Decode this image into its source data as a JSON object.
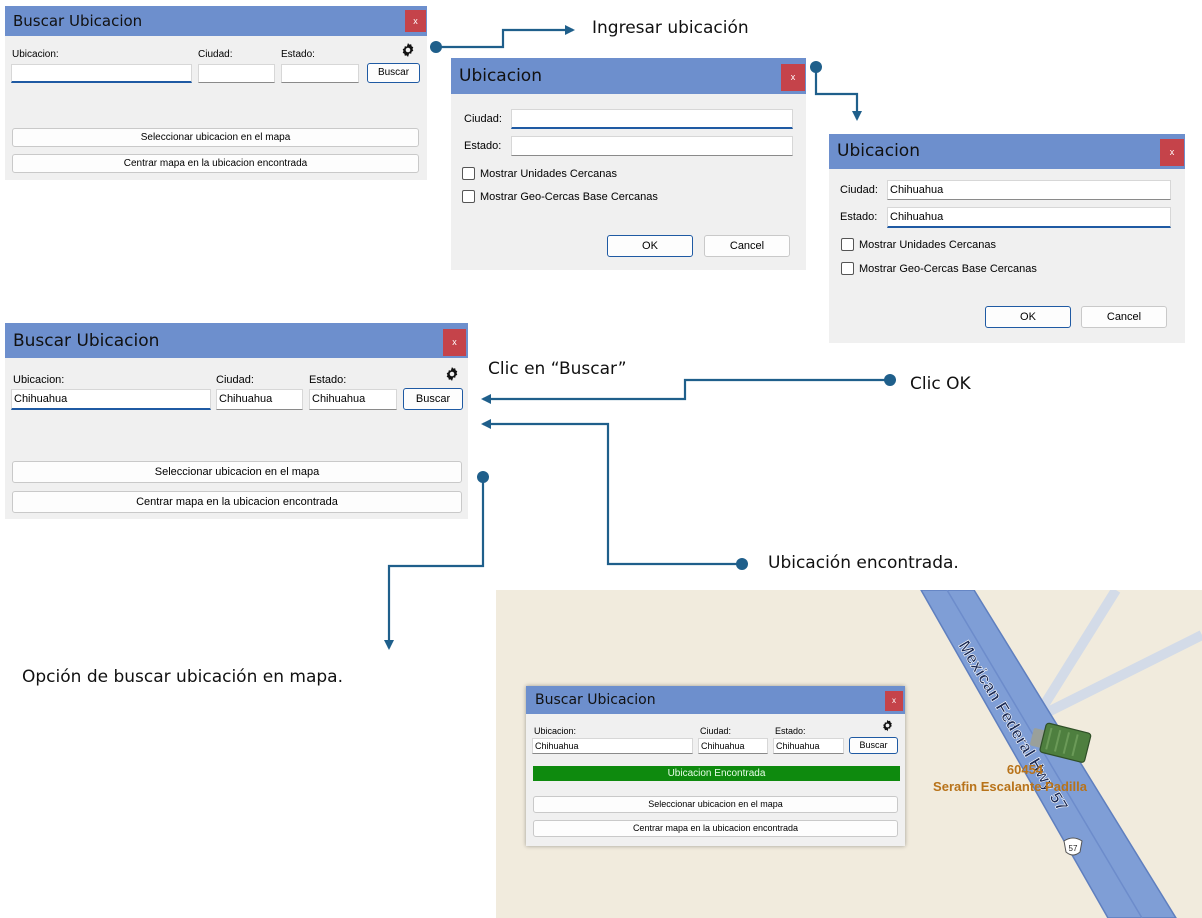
{
  "colors": {
    "titlebar": "#6d8fcd",
    "close": "#c5434a",
    "arrow": "#1f5f8b",
    "found": "#0e8a0e",
    "road_label": "#b8731a"
  },
  "icons": {
    "gear": "gear-icon",
    "close": "close-icon"
  },
  "win1": {
    "title": "Buscar Ubicacion",
    "close": "x",
    "lbl_ubic": "Ubicacion:",
    "lbl_ciudad": "Ciudad:",
    "lbl_estado": "Estado:",
    "val_ubic": "",
    "val_ciudad": "",
    "val_estado": "",
    "buscar": "Buscar",
    "btn_sel": "Seleccionar ubicacion en el mapa",
    "btn_centrar": "Centrar mapa en la ubicacion encontrada"
  },
  "dlg1": {
    "title": "Ubicacion",
    "close": "x",
    "lbl_ciudad": "Ciudad:",
    "lbl_estado": "Estado:",
    "val_ciudad": "",
    "val_estado": "",
    "chk_unidades": "Mostrar Unidades Cercanas",
    "chk_geocercas": "Mostrar Geo-Cercas Base Cercanas",
    "ok": "OK",
    "cancel": "Cancel"
  },
  "dlg2": {
    "title": "Ubicacion",
    "close": "x",
    "lbl_ciudad": "Ciudad:",
    "lbl_estado": "Estado:",
    "val_ciudad": "Chihuahua",
    "val_estado": "Chihuahua",
    "chk_unidades": "Mostrar Unidades Cercanas",
    "chk_geocercas": "Mostrar Geo-Cercas Base Cercanas",
    "ok": "OK",
    "cancel": "Cancel"
  },
  "win2": {
    "title": "Buscar Ubicacion",
    "close": "x",
    "lbl_ubic": "Ubicacion:",
    "lbl_ciudad": "Ciudad:",
    "lbl_estado": "Estado:",
    "val_ubic": "Chihuahua",
    "val_ciudad": "Chihuahua",
    "val_estado": "Chihuahua",
    "buscar": "Buscar",
    "btn_sel": "Seleccionar ubicacion en el mapa",
    "btn_centrar": "Centrar mapa en la ubicacion encontrada"
  },
  "win3": {
    "title": "Buscar Ubicacion",
    "close": "x",
    "lbl_ubic": "Ubicacion:",
    "lbl_ciudad": "Ciudad:",
    "lbl_estado": "Estado:",
    "val_ubic": "Chihuahua",
    "val_ciudad": "Chihuahua",
    "val_estado": "Chihuahua",
    "buscar": "Buscar",
    "status": "Ubicacion Encontrada",
    "btn_sel": "Seleccionar ubicacion en el mapa",
    "btn_centrar": "Centrar mapa en la ubicacion encontrada"
  },
  "annotations": {
    "ingresar": "Ingresar ubicación",
    "clic_buscar": "Clic en “Buscar”",
    "clic_ok": "Clic OK",
    "encontrada": "Ubicación encontrada.",
    "opcion": "Opción de buscar ubicación en mapa."
  },
  "map": {
    "road_name": "Mexican Federal Hwy 57",
    "shield": "57",
    "unit_id": "60454",
    "driver": "Serafin Escalante Padilla"
  }
}
